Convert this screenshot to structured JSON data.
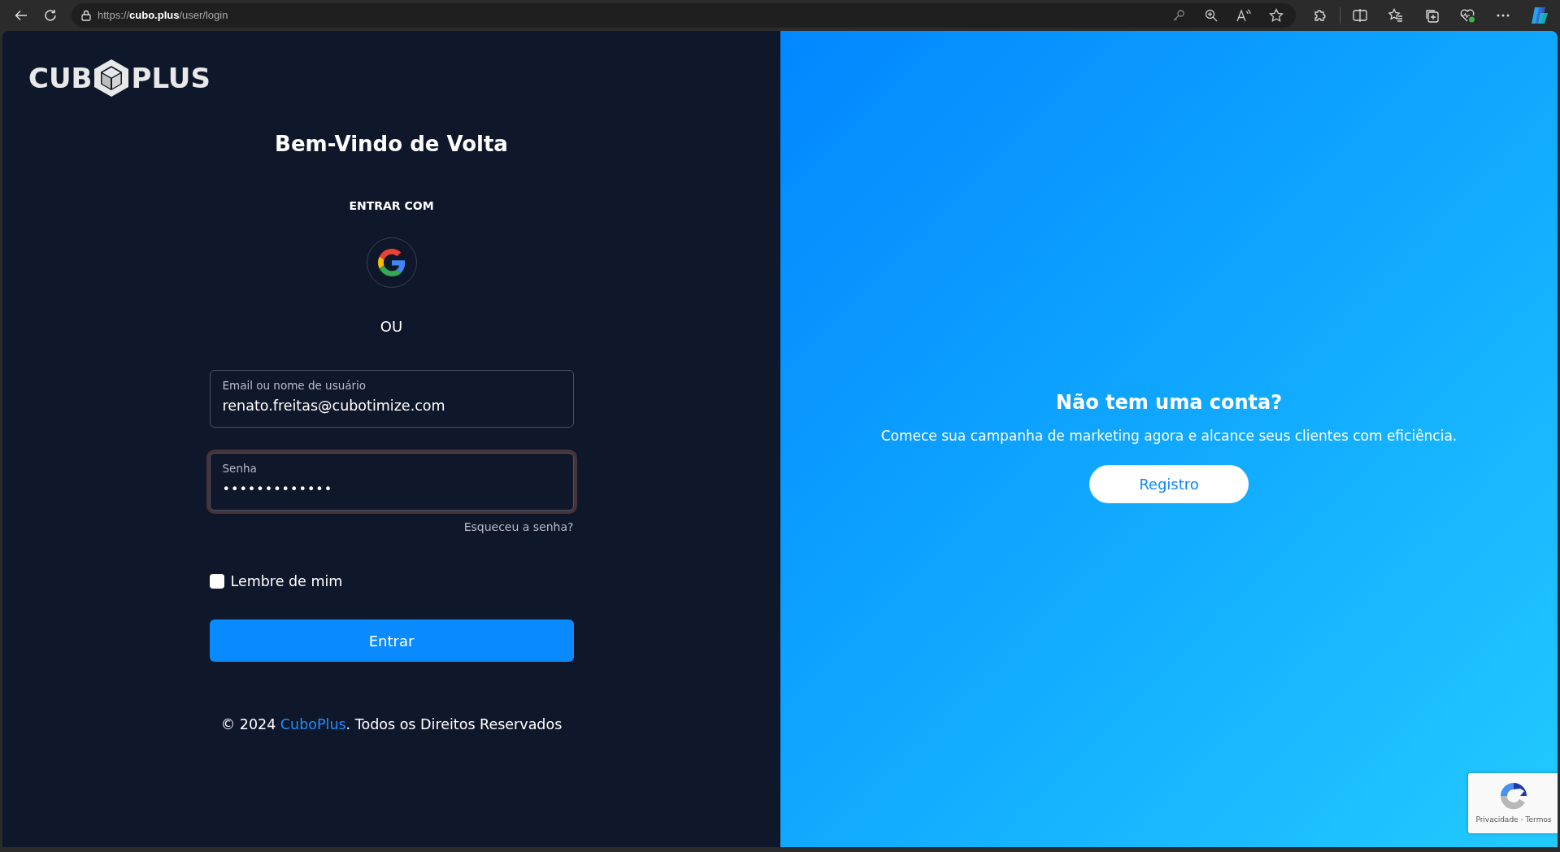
{
  "browser": {
    "url": "https://**cubo.plus**/user/login"
  },
  "logo": {
    "left": "CUB",
    "right": "PLUS"
  },
  "login": {
    "title": "Bem-Vindo de Volta",
    "social_label": "ENTRAR COM",
    "divider": "OU",
    "fields": [
      {
        "kind": "text",
        "label": "Email ou nome de usuário",
        "value": "renato.freitas@cubotimize.com",
        "focused": false
      },
      {
        "kind": "password",
        "label": "Senha",
        "value": "•••••••••••••",
        "focused": true
      }
    ],
    "forgot": "Esqueceu a senha?",
    "remember": {
      "label": "Lembre de mim",
      "checked": false
    },
    "submit": "Entrar",
    "footer": {
      "prefix": "© 2024 ",
      "link": "CuboPlus",
      "suffix": ". Todos os Direitos Reservados"
    }
  },
  "signup": {
    "title": "Não tem uma conta?",
    "text": "Comece sua campanha de marketing agora e alcance seus clientes com eficiência.",
    "button": "Registro"
  },
  "recaptcha": {
    "text": "Privacidade - Termos"
  }
}
